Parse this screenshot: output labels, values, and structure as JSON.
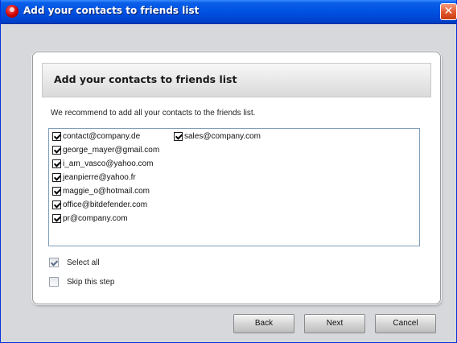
{
  "window": {
    "title": "Add your contacts to friends list",
    "close_glyph": "✕"
  },
  "panel": {
    "heading": "Add your contacts to friends list",
    "recommendation": "We recommend to add all your contacts to the friends list."
  },
  "contacts": {
    "items": [
      {
        "email": "contact@company.de",
        "checked": true
      },
      {
        "email": "george_mayer@gmail.com",
        "checked": true
      },
      {
        "email": "i_am_vasco@yahoo.com",
        "checked": true
      },
      {
        "email": "jeanpierre@yahoo.fr",
        "checked": true
      },
      {
        "email": "maggie_o@hotmail.com",
        "checked": true
      },
      {
        "email": "office@bitdefender.com",
        "checked": true
      },
      {
        "email": "pr@company.com",
        "checked": true
      },
      {
        "email": "sales@company.com",
        "checked": true
      }
    ]
  },
  "options": {
    "select_all": {
      "label": "Select all",
      "checked": true
    },
    "skip_step": {
      "label": "Skip this step",
      "checked": false
    }
  },
  "buttons": {
    "back": "Back",
    "next": "Next",
    "cancel": "Cancel"
  },
  "icons": {
    "app": "bitdefender-logo-icon",
    "close": "close-icon",
    "checkbox": "checkbox-icon"
  },
  "colors": {
    "titlebar": "#0054e3",
    "close_button": "#e2582d",
    "window_bg": "#d6d8dc"
  }
}
